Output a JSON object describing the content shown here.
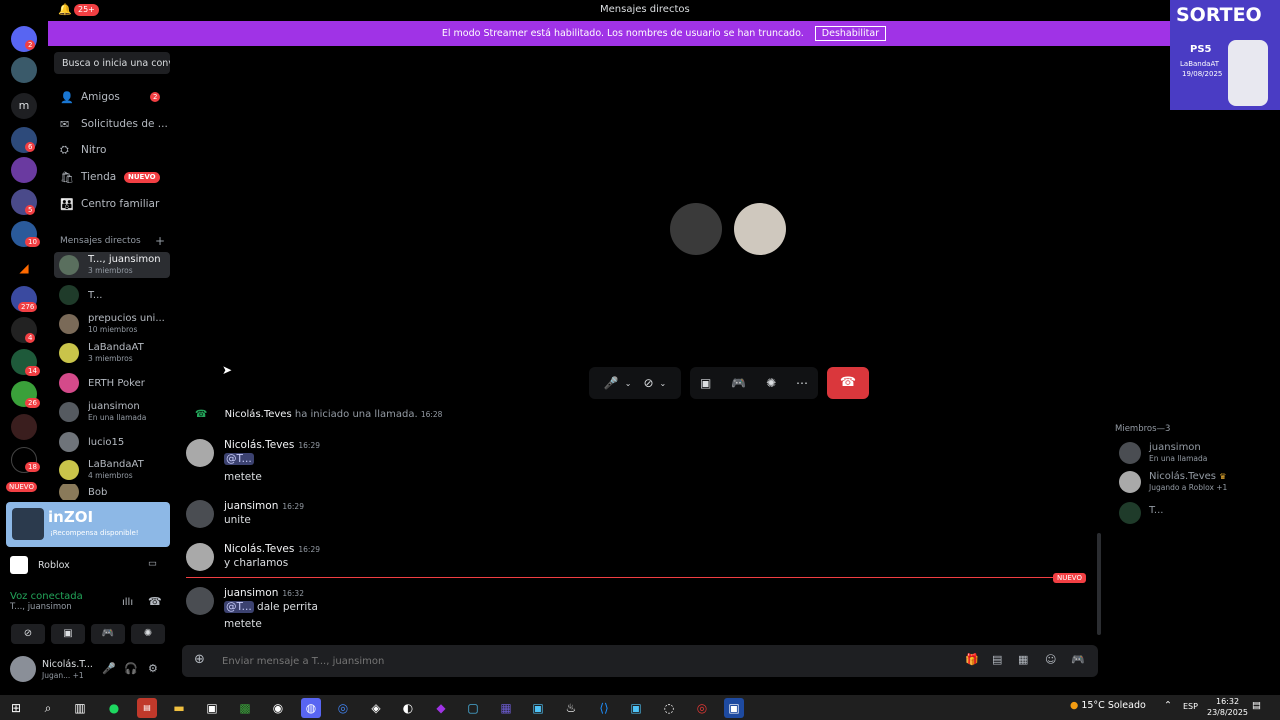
{
  "titlebar": {
    "title": "Mensajes directos",
    "notif_count": "25+"
  },
  "streamer_banner": {
    "text": "El modo Streamer está habilitado. Los nombres de usuario se han truncado.",
    "button": "Deshabilitar"
  },
  "servers": {
    "items": [
      {
        "badge": "2"
      },
      {
        "badge": ""
      },
      {
        "label": "m"
      },
      {
        "badge": "6"
      },
      {
        "badge": ""
      },
      {
        "badge": "5"
      },
      {
        "badge": "10"
      },
      {
        "badge": ""
      },
      {
        "badge": "276"
      },
      {
        "badge": "4"
      },
      {
        "badge": "14"
      },
      {
        "badge": "26"
      },
      {
        "badge": ""
      },
      {
        "badge": "18"
      }
    ],
    "nuevo_label": "NUEVO"
  },
  "sidebar": {
    "search_placeholder": "Busca o inicia una conv...",
    "nav": [
      {
        "label": "Amigos",
        "badge": "2"
      },
      {
        "label": "Solicitudes de ..."
      },
      {
        "label": "Nitro"
      },
      {
        "label": "Tienda",
        "tag": "NUEVO"
      },
      {
        "label": "Centro familiar"
      }
    ],
    "dm_header": "Mensajes directos",
    "dms": [
      {
        "name": "T..., juansimon",
        "sub": "3 miembros",
        "color": "#5a6f5e"
      },
      {
        "name": "T...",
        "sub": "",
        "color": "#1f3b2a"
      },
      {
        "name": "prepucios uni...",
        "sub": "10 miembros",
        "color": "#7a6a58"
      },
      {
        "name": "LaBandaAT",
        "sub": "3 miembros",
        "color": "#c9c44a"
      },
      {
        "name": "ERTH Poker",
        "sub": "",
        "color": "#d44a8a"
      },
      {
        "name": "juansimon",
        "sub": "En una llamada",
        "color": "#555a60"
      },
      {
        "name": "lucio15",
        "sub": "",
        "color": "#6f747a"
      },
      {
        "name": "LaBandaAT",
        "sub": "4 miembros",
        "color": "#c9c44a"
      },
      {
        "name": "Bob",
        "sub": "",
        "color": "#8a7a5a"
      }
    ]
  },
  "activity": {
    "title": "inZOI",
    "subtitle": "¡Recompensa disponible!"
  },
  "game_row": {
    "name": "Roblox"
  },
  "voice": {
    "status": "Voz conectada",
    "channel": "T..., juansimon"
  },
  "user": {
    "name": "Nicolás.T...",
    "status": "Jugan... +1"
  },
  "chat": {
    "system": {
      "author": "Nicolás.Teves",
      "text": "ha iniciado una llamada.",
      "time": "16:28"
    },
    "messages": [
      {
        "author": "Nicolás.Teves",
        "time": "16:29",
        "mention": "@T...",
        "line1": "",
        "line2": "metete",
        "color": "#a9a9a9"
      },
      {
        "author": "juansimon",
        "time": "16:29",
        "line1": "unite",
        "color": "#4a4d52"
      },
      {
        "author": "Nicolás.Teves",
        "time": "16:29",
        "line1": "y charlamos",
        "color": "#a9a9a9"
      },
      {
        "author": "juansimon",
        "time": "16:32",
        "mention": "@T...",
        "line1": "dale perrita",
        "line2": "metete",
        "color": "#4a4d52"
      }
    ],
    "new_label": "NUEVO",
    "composer_placeholder": "Enviar mensaje a T..., juansimon"
  },
  "members": {
    "header": "Miembros—3",
    "items": [
      {
        "name": "juansimon",
        "sub": "En una llamada",
        "color": "#4a4d52"
      },
      {
        "name": "Nicolás.Teves",
        "sub": "Jugando a Roblox +1",
        "color": "#a9a9a9"
      },
      {
        "name": "T...",
        "sub": "",
        "color": "#1f3b2a"
      }
    ]
  },
  "promo": {
    "title": "SORTEO",
    "product": "PS5",
    "line1": "LaBandaAT",
    "line2": "19/08/2025"
  },
  "taskbar": {
    "weather": "15°C Soleado",
    "lang": "ESP",
    "time": "16:32",
    "date": "23/8/2025"
  },
  "colors": {
    "accent": "#5865f2",
    "streamer": "#a033e6",
    "danger": "#da373c",
    "online": "#23a55a"
  }
}
